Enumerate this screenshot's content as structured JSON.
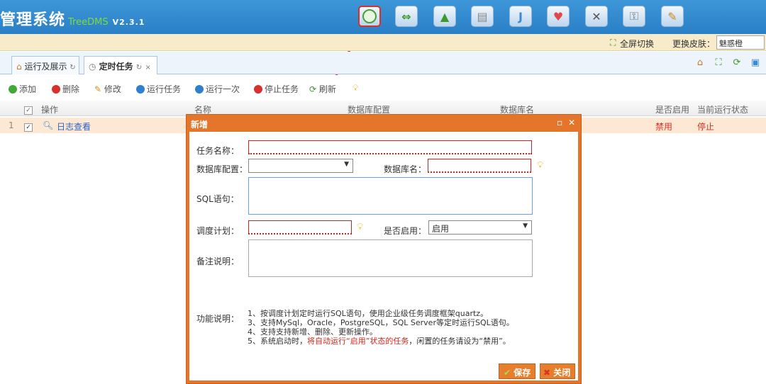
{
  "header": {
    "title": "管理系统",
    "brand_sub": "TreeDMS",
    "version": "V2.3.1",
    "toolbar_icons": [
      "clock-icon",
      "arrows-icon",
      "chart-icon",
      "database-icon",
      "document-icon",
      "heart-icon",
      "tools-icon",
      "key-icon",
      "user-icon"
    ]
  },
  "subbar": {
    "fullscreen_label": "全屏切换",
    "skin_label": "更换皮肤：",
    "skin_value": "魅惑橙"
  },
  "tabs": [
    {
      "label": "运行及展示"
    },
    {
      "label": "定时任务"
    }
  ],
  "toolbar": {
    "add": "添加",
    "delete": "删除",
    "edit": "修改",
    "run_task": "运行任务",
    "run_once": "运行一次",
    "stop_task": "停止任务",
    "refresh": "刷新"
  },
  "grid": {
    "columns": [
      "操作",
      "名称",
      "数据库配置",
      "数据库名",
      "是否启用",
      "当前运行状态"
    ],
    "rows": [
      {
        "index": "1",
        "action": "日志查看",
        "enabled": "禁用",
        "status": "停止"
      }
    ]
  },
  "dialog": {
    "title": "新增",
    "task_name_label": "任务名称：",
    "db_config_label": "数据库配置：",
    "db_name_label": "数据库名：",
    "sql_label": "SQL语句：",
    "schedule_label": "调度计划：",
    "enabled_label": "是否启用：",
    "enabled_value": "启用",
    "remark_label": "备注说明：",
    "feature_label": "功能说明：",
    "desc_line1": "1、按调度计划定时运行SQL语句，使用企业级任务调度框架quartz。",
    "desc_line2": "3、支持MySql，Oracle，PostgreSQL，SQL Server等定时运行SQL语句。",
    "desc_line3": "4、支持支持新增、删除、更新操作。",
    "desc_line4_a": "5、系统启动时，",
    "desc_line4_red": "将自动运行“启用”状态的任务",
    "desc_line4_b": "，闲置的任务请设为“禁用”。",
    "save": "保存",
    "close": "关闭"
  },
  "colors": {
    "header_blue": "#2f87cc",
    "dialog_orange": "#e5752b",
    "required_red": "#c6261b",
    "highlight_row": "#fde8d3"
  }
}
